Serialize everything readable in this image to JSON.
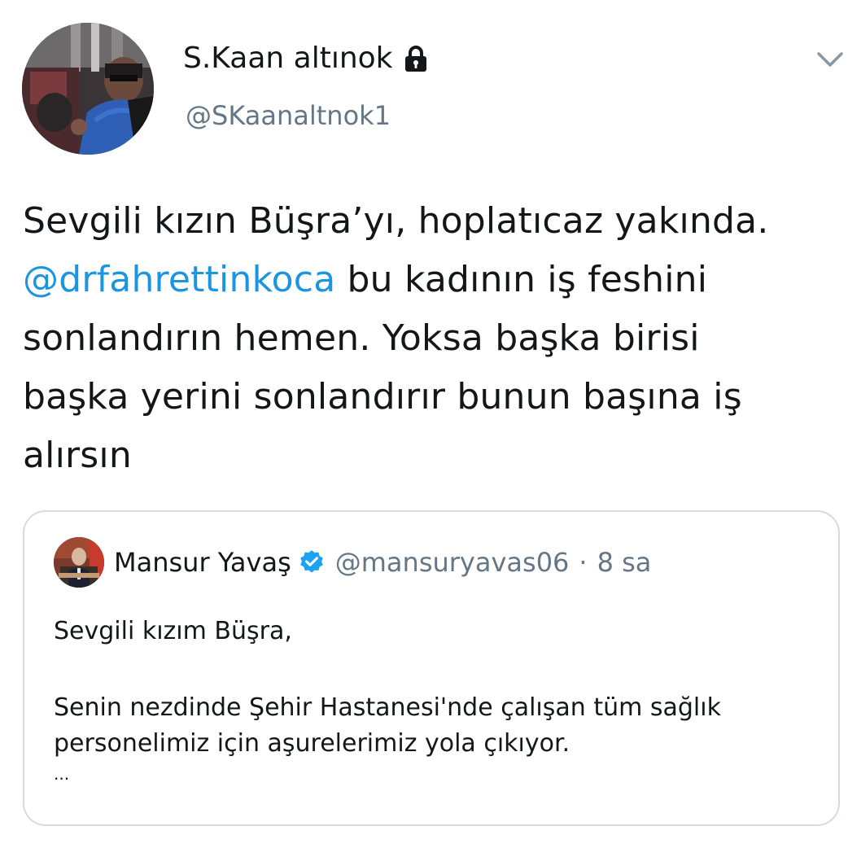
{
  "tweet": {
    "author": {
      "display_name": "S.Kaan altınok",
      "handle": "@SKaanaltnok1",
      "protected_icon": "lock-icon",
      "avatar": "profile-photo"
    },
    "menu_icon": "chevron-down-icon",
    "text": {
      "line1": "Sevgili kızın Büşra’yı, hoplatıcaz yakında.",
      "mention": "@drfahrettinkoca",
      "line2_rest": " bu kadının iş feshini",
      "line3": "sonlandırın hemen. Yoksa başka birisi",
      "line4": "başka yerini sonlandırır bunun başına iş",
      "line5": "alırsın"
    },
    "quoted_tweet": {
      "author_name": "Mansur Yavaş",
      "verified_icon": "verified-badge-icon",
      "handle": "@mansuryavas06",
      "separator": "·",
      "time": "8 sa",
      "text": {
        "line1": "Sevgili kızım Büşra,",
        "line2": "Senin nezdinde Şehir Hastanesi'nde çalışan tüm sağlık",
        "line3": "personelimiz için aşurelerimiz yola çıkıyor.",
        "ellipsis": "..."
      }
    },
    "colors": {
      "text": "#14171a",
      "secondary": "#657786",
      "link": "#1b95e0",
      "border": "#d5dbe0"
    }
  }
}
